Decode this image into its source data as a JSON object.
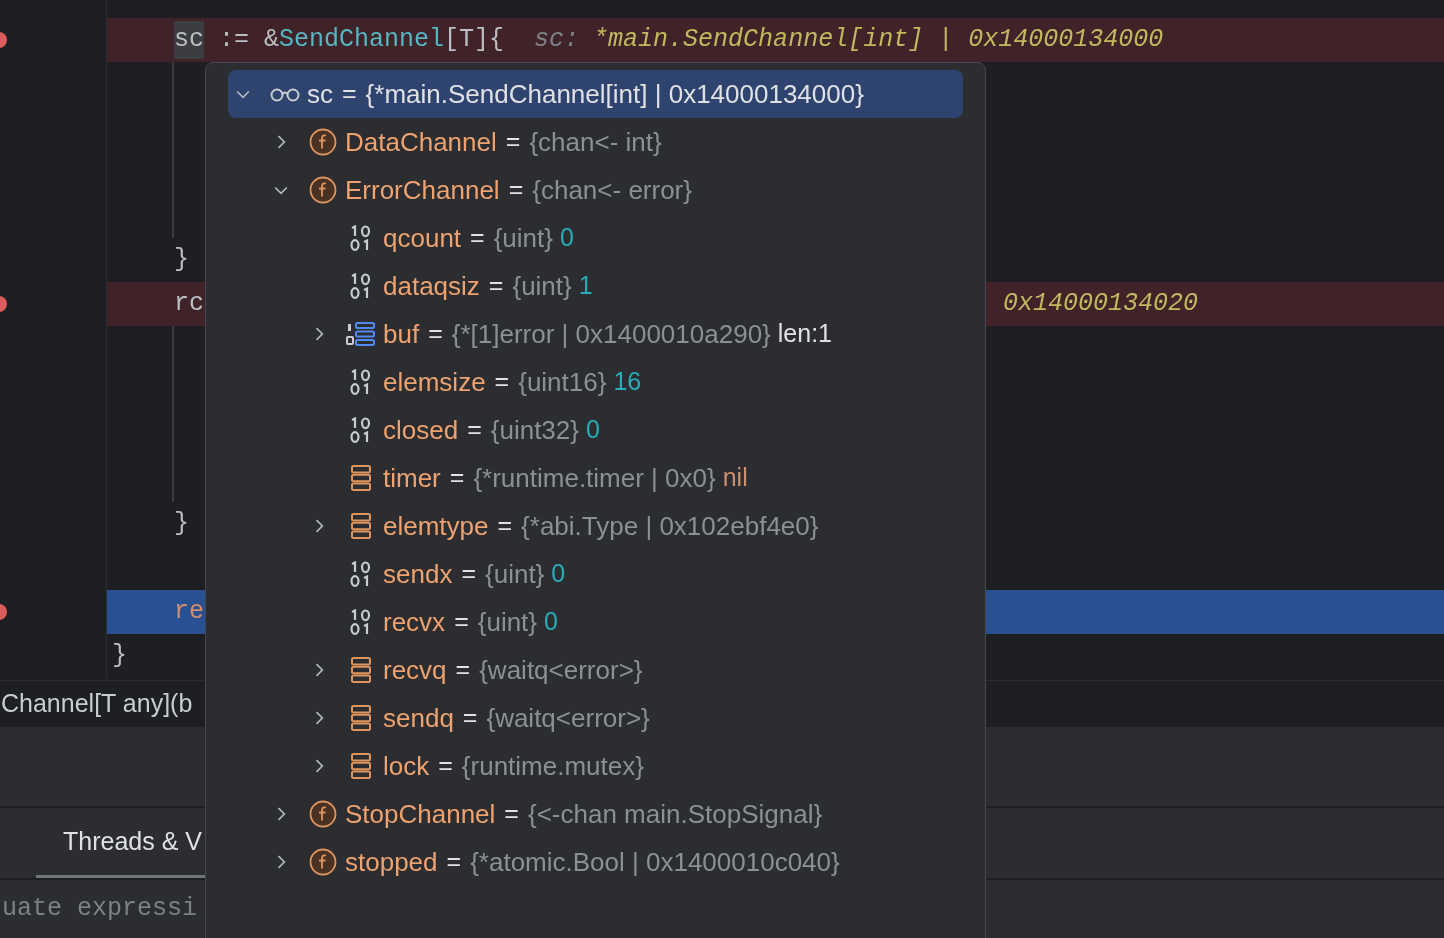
{
  "editor": {
    "lines": [
      {
        "kind": "empty",
        "breakpoint": false,
        "execution_point": false
      },
      {
        "kind": "nested",
        "breakpoint": true,
        "execution_point": false,
        "segments": [
          {
            "kind": "caret-word",
            "text": "sc"
          },
          {
            "kind": "plain",
            "text": " := &"
          },
          {
            "kind": "type",
            "text": "SendChannel"
          },
          {
            "kind": "plain",
            "text": "[T]{"
          },
          {
            "kind": "inlay-label",
            "text": "sc:"
          },
          {
            "kind": "inlay-value",
            "text": "*main.SendChannel[int] | 0x14000134000"
          }
        ]
      },
      {
        "kind": "blank",
        "breakpoint": false,
        "execution_point": false
      },
      {
        "kind": "blank",
        "breakpoint": false,
        "execution_point": false
      },
      {
        "kind": "blank",
        "breakpoint": false,
        "execution_point": false
      },
      {
        "kind": "blank",
        "breakpoint": false,
        "execution_point": false
      },
      {
        "kind": "nested",
        "breakpoint": false,
        "execution_point": false,
        "segments": [
          {
            "kind": "plain",
            "text": "}"
          }
        ]
      },
      {
        "kind": "nested",
        "breakpoint": true,
        "execution_point": false,
        "segments": [
          {
            "kind": "plain",
            "text": "rc"
          }
        ],
        "right_segments": [
          {
            "kind": "inlay-value",
            "text": "0x14000134020"
          }
        ]
      },
      {
        "kind": "blank",
        "breakpoint": false,
        "execution_point": false
      },
      {
        "kind": "blank",
        "breakpoint": false,
        "execution_point": false
      },
      {
        "kind": "blank",
        "breakpoint": false,
        "execution_point": false
      },
      {
        "kind": "blank",
        "breakpoint": false,
        "execution_point": false
      },
      {
        "kind": "nested",
        "breakpoint": false,
        "execution_point": false,
        "segments": [
          {
            "kind": "plain",
            "text": "}"
          }
        ]
      },
      {
        "kind": "empty",
        "breakpoint": false,
        "execution_point": false
      },
      {
        "kind": "nested",
        "breakpoint": true,
        "execution_point": true,
        "segments": [
          {
            "kind": "keyword",
            "text": "re"
          }
        ]
      },
      {
        "kind": "top",
        "breakpoint": false,
        "execution_point": false,
        "segments": [
          {
            "kind": "plain",
            "text": "}"
          }
        ]
      }
    ]
  },
  "breadcrumb": "Channel[T any](b",
  "debug_panel": {
    "tabs": [
      {
        "label": "Threads & V",
        "selected": true
      }
    ],
    "evaluate": {
      "placeholder": "uate expressi"
    }
  },
  "variables_popup": {
    "tree": [
      {
        "kind": "watch",
        "name": "sc",
        "operator": "=",
        "type": "{*main.SendChannel[int] | 0x14000134000}",
        "expanded": true,
        "selected": true,
        "children": [
          {
            "kind": "field",
            "name": "DataChannel",
            "operator": "=",
            "type": "{chan<- int}",
            "expanded": false,
            "selected": false
          },
          {
            "kind": "field",
            "name": "ErrorChannel",
            "operator": "=",
            "type": "{chan<- error}",
            "expanded": true,
            "selected": false,
            "children": [
              {
                "kind": "binary",
                "name": "qcount",
                "operator": "=",
                "type": "{uint}",
                "value": {
                  "kind": "number",
                  "text": "0"
                },
                "selected": false
              },
              {
                "kind": "binary",
                "name": "dataqsiz",
                "operator": "=",
                "type": "{uint}",
                "value": {
                  "kind": "number",
                  "text": "1"
                },
                "selected": false
              },
              {
                "kind": "array",
                "name": "buf",
                "operator": "=",
                "type": "{*[1]error | 0x1400010a290}",
                "value": {
                  "kind": "plain",
                  "text": "len:1"
                },
                "expanded": false,
                "selected": false
              },
              {
                "kind": "binary",
                "name": "elemsize",
                "operator": "=",
                "type": "{uint16}",
                "value": {
                  "kind": "number",
                  "text": "16"
                },
                "selected": false
              },
              {
                "kind": "binary",
                "name": "closed",
                "operator": "=",
                "type": "{uint32}",
                "value": {
                  "kind": "number",
                  "text": "0"
                },
                "selected": false
              },
              {
                "kind": "struct",
                "name": "timer",
                "operator": "=",
                "type": "{*runtime.timer | 0x0}",
                "value": {
                  "kind": "keyword",
                  "text": "nil"
                },
                "selected": false
              },
              {
                "kind": "struct",
                "name": "elemtype",
                "operator": "=",
                "type": "{*abi.Type | 0x102ebf4e0}",
                "expanded": false,
                "selected": false
              },
              {
                "kind": "binary",
                "name": "sendx",
                "operator": "=",
                "type": "{uint}",
                "value": {
                  "kind": "number",
                  "text": "0"
                },
                "selected": false
              },
              {
                "kind": "binary",
                "name": "recvx",
                "operator": "=",
                "type": "{uint}",
                "value": {
                  "kind": "number",
                  "text": "0"
                },
                "selected": false
              },
              {
                "kind": "struct",
                "name": "recvq",
                "operator": "=",
                "type": "{waitq<error>}",
                "expanded": false,
                "selected": false
              },
              {
                "kind": "struct",
                "name": "sendq",
                "operator": "=",
                "type": "{waitq<error>}",
                "expanded": false,
                "selected": false
              },
              {
                "kind": "struct",
                "name": "lock",
                "operator": "=",
                "type": "{runtime.mutex}",
                "expanded": false,
                "selected": false
              }
            ]
          },
          {
            "kind": "field",
            "name": "StopChannel",
            "operator": "=",
            "type": "{<-chan main.StopSignal}",
            "expanded": false,
            "selected": false
          },
          {
            "kind": "field",
            "name": "stopped",
            "operator": "=",
            "type": "{*atomic.Bool | 0x1400010c040}",
            "expanded": false,
            "selected": false
          }
        ]
      }
    ]
  }
}
